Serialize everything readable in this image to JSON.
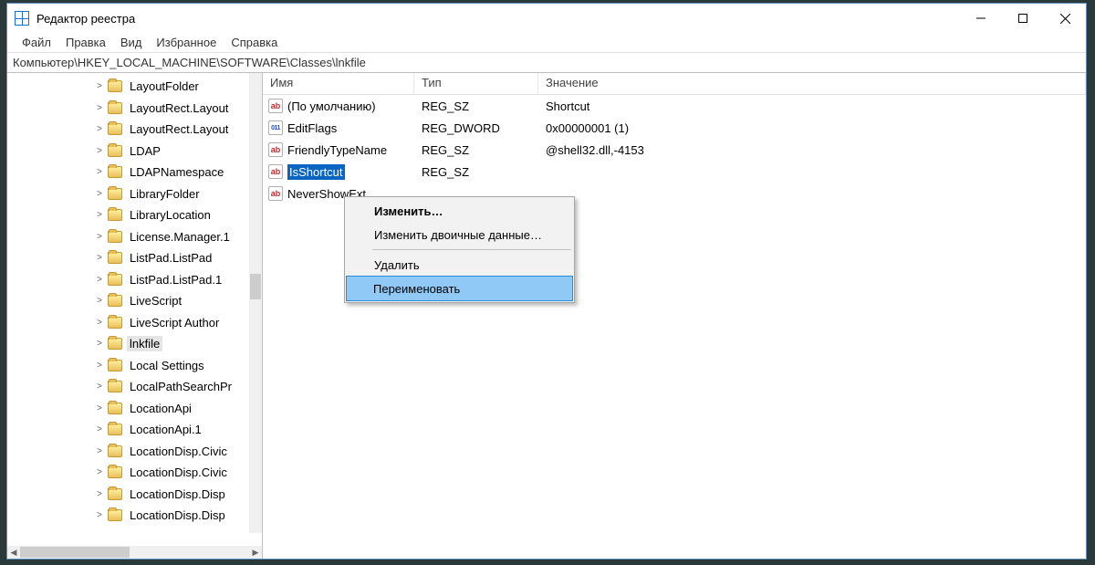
{
  "title": "Редактор реестра",
  "menu": [
    "Файл",
    "Правка",
    "Вид",
    "Избранное",
    "Справка"
  ],
  "address": "Компьютер\\HKEY_LOCAL_MACHINE\\SOFTWARE\\Classes\\lnkfile",
  "tree": [
    {
      "name": "LayoutFolder"
    },
    {
      "name": "LayoutRect.Layout"
    },
    {
      "name": "LayoutRect.Layout"
    },
    {
      "name": "LDAP"
    },
    {
      "name": "LDAPNamespace"
    },
    {
      "name": "LibraryFolder"
    },
    {
      "name": "LibraryLocation"
    },
    {
      "name": "License.Manager.1"
    },
    {
      "name": "ListPad.ListPad"
    },
    {
      "name": "ListPad.ListPad.1"
    },
    {
      "name": "LiveScript"
    },
    {
      "name": "LiveScript Author"
    },
    {
      "name": "lnkfile",
      "selected": true
    },
    {
      "name": "Local Settings"
    },
    {
      "name": "LocalPathSearchPr"
    },
    {
      "name": "LocationApi"
    },
    {
      "name": "LocationApi.1"
    },
    {
      "name": "LocationDisp.Civic"
    },
    {
      "name": "LocationDisp.Civic"
    },
    {
      "name": "LocationDisp.Disp"
    },
    {
      "name": "LocationDisp.Disp"
    }
  ],
  "columns": {
    "name": "Имя",
    "type": "Тип",
    "value": "Значение"
  },
  "values": [
    {
      "icon": "sz",
      "name": "(По умолчанию)",
      "type": "REG_SZ",
      "value": "Shortcut"
    },
    {
      "icon": "dw",
      "name": "EditFlags",
      "type": "REG_DWORD",
      "value": "0x00000001 (1)"
    },
    {
      "icon": "sz",
      "name": "FriendlyTypeName",
      "type": "REG_SZ",
      "value": "@shell32.dll,-4153"
    },
    {
      "icon": "sz",
      "name": "IsShortcut",
      "type": "REG_SZ",
      "value": "",
      "selected": true
    },
    {
      "icon": "sz",
      "name": "NeverShowExt",
      "type": "",
      "value": ""
    }
  ],
  "context_menu": {
    "modify": "Изменить…",
    "modify_binary": "Изменить двоичные данные…",
    "delete": "Удалить",
    "rename": "Переименовать"
  }
}
